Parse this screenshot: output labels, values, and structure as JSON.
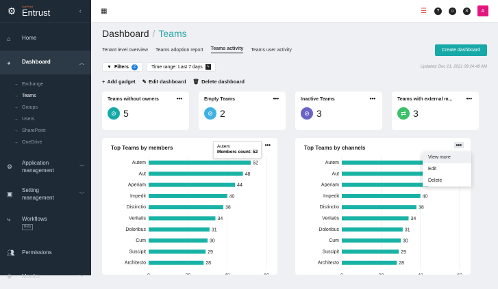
{
  "brand": {
    "sub": "AvePoint",
    "name": "Entrust"
  },
  "sidebar": {
    "items": [
      {
        "label": "Home",
        "icon": "home-icon"
      },
      {
        "label": "Dashboard",
        "icon": "pie-chart-icon",
        "active": true
      },
      {
        "label": "Application management",
        "icon": "gear-icon"
      },
      {
        "label": "Setting management",
        "icon": "briefcase-icon"
      },
      {
        "label": "Workflows",
        "icon": "workflow-icon",
        "badge": "Beta"
      },
      {
        "label": "Permissions",
        "icon": "users-icon"
      },
      {
        "label": "Monitor",
        "icon": "monitor-icon"
      }
    ],
    "sub_items": [
      "Exchange",
      "Teams",
      "Groups",
      "Users",
      "SharePoint",
      "OneDrive"
    ]
  },
  "header": {
    "avatar": "A"
  },
  "page": {
    "title": "Dashboard",
    "current": "Teams",
    "tabs": [
      "Tenant level overview",
      "Teams adoption report",
      "Teams activity",
      "Teams user activity"
    ],
    "create_button": "Create dashboard",
    "filters_label": "Filters",
    "filters_count": "2",
    "time_range": "Time range: Last 7 days",
    "updated": "Updated: Dec 21, 2021 09:24:48 AM",
    "actions": [
      "Add gadget",
      "Edit dashboard",
      "Delete dashboard"
    ]
  },
  "cards": [
    {
      "title": "Teams without owners",
      "value": "5",
      "color": "#16a9a8"
    },
    {
      "title": "Empty Teams",
      "value": "2",
      "color": "#3fb1e3"
    },
    {
      "title": "Inactive Teams",
      "value": "3",
      "color": "#6a63c6"
    },
    {
      "title": "Teams with external m...",
      "value": "3",
      "color": "#3cc06a"
    }
  ],
  "menu_glyph": "•••",
  "tooltip": {
    "name": "Autem",
    "label": "Members count: 52"
  },
  "dropdown": [
    "View more",
    "Edit",
    "Delete"
  ],
  "chart_data": [
    {
      "type": "bar",
      "title": "Top Teams by members",
      "categories": [
        "Autem",
        "Aut",
        "Aperiam",
        "Impedit",
        "Distinctio",
        "Veritatis",
        "Doloribus",
        "Cum",
        "Suscipit",
        "Architecto"
      ],
      "values": [
        52,
        48,
        44,
        40,
        38,
        34,
        31,
        30,
        29,
        28
      ],
      "xlim": [
        0,
        60
      ],
      "xticks": [
        0,
        20,
        40,
        60
      ],
      "color": "#19b3a6"
    },
    {
      "type": "bar",
      "title": "Top Teams by channels",
      "categories": [
        "Autem",
        "Aut",
        "Aperiam",
        "Impedit",
        "Distinctio",
        "Veritatis",
        "Doloribus",
        "Cum",
        "Suscipit",
        "Architecto"
      ],
      "values": [
        52,
        48,
        44,
        40,
        38,
        34,
        31,
        30,
        29,
        28
      ],
      "xlim": [
        0,
        60
      ],
      "xticks": [
        0,
        20,
        40,
        60
      ],
      "color": "#19b3a6"
    }
  ]
}
